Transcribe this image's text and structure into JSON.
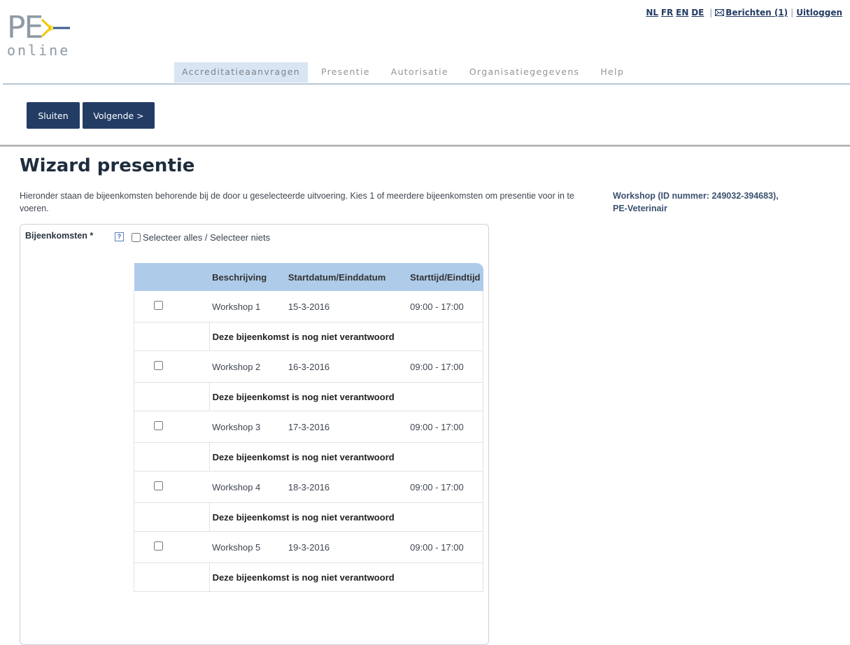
{
  "logo": {
    "text_main": "PE",
    "text_sub": "online"
  },
  "toplinks": {
    "languages": [
      "NL",
      "FR",
      "EN",
      "DE"
    ],
    "messages": "Berichten (1)",
    "logout": "Uitloggen"
  },
  "nav": {
    "tabs": [
      {
        "label": "Accreditatieaanvragen",
        "active": true
      },
      {
        "label": "Presentie",
        "active": false
      },
      {
        "label": "Autorisatie",
        "active": false
      },
      {
        "label": "Organisatiegegevens",
        "active": false
      },
      {
        "label": "Help",
        "active": false
      }
    ]
  },
  "toolbar": {
    "close_label": "Sluiten",
    "next_label": "Volgende >"
  },
  "page": {
    "title": "Wizard presentie",
    "intro": "Hieronder staan de bijeenkomsten behorende bij de door u geselecteerde uitvoering. Kies 1 of meerdere bijeenkomsten om presentie voor in te voeren.",
    "side_info_line1": "Workshop (ID nummer: 249032-394683),",
    "side_info_line2": "PE-Veterinair"
  },
  "form": {
    "field_label": "Bijeenkomsten",
    "required_mark": "*",
    "help_glyph": "?",
    "select_all_label": "Selecteer alles / Selecteer niets",
    "columns": [
      "Beschrijving",
      "Startdatum/Einddatum",
      "Starttijd/Eindtijd"
    ],
    "rows": [
      {
        "description": "Workshop 1",
        "date": "15-3-2016",
        "time": "09:00 - 17:00",
        "note": "Deze bijeenkomst is nog niet verantwoord"
      },
      {
        "description": "Workshop 2",
        "date": "16-3-2016",
        "time": "09:00 - 17:00",
        "note": "Deze bijeenkomst is nog niet verantwoord"
      },
      {
        "description": "Workshop 3",
        "date": "17-3-2016",
        "time": "09:00 - 17:00",
        "note": "Deze bijeenkomst is nog niet verantwoord"
      },
      {
        "description": "Workshop 4",
        "date": "18-3-2016",
        "time": "09:00 - 17:00",
        "note": "Deze bijeenkomst is nog niet verantwoord"
      },
      {
        "description": "Workshop 5",
        "date": "19-3-2016",
        "time": "09:00 - 17:00",
        "note": "Deze bijeenkomst is nog niet verantwoord"
      }
    ]
  },
  "colors": {
    "brand_dark": "#233c64",
    "tab_active_bg": "#d8e5f2",
    "table_header_bg": "#aecbe9",
    "logo_arrow": "#f2c400"
  }
}
